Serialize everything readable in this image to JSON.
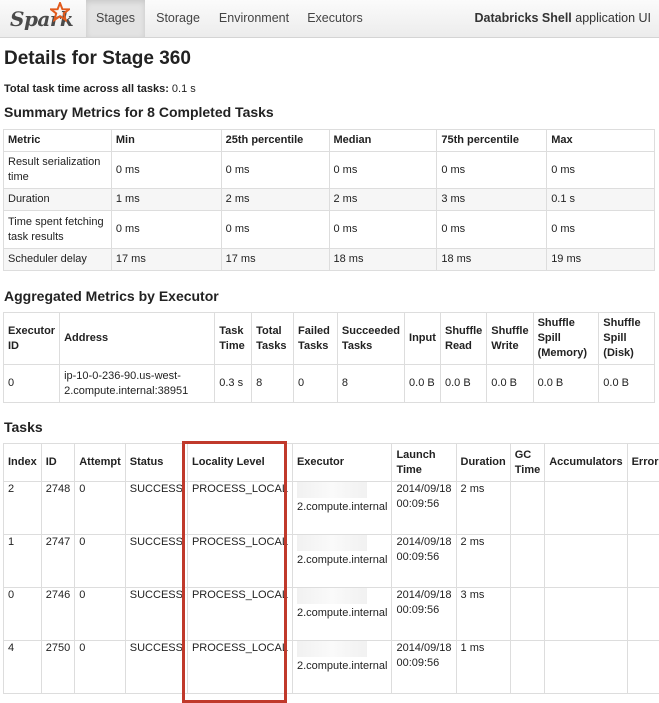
{
  "nav": {
    "brand": "Spark",
    "tabs": [
      "Stages",
      "Storage",
      "Environment",
      "Executors"
    ],
    "active_tab": "Stages",
    "app_name": "Databricks Shell",
    "app_suffix": " application UI"
  },
  "page": {
    "title": "Details for Stage 360",
    "total_label": "Total task time across all tasks:",
    "total_value": " 0.1 s"
  },
  "summary": {
    "heading": "Summary Metrics for 8 Completed Tasks",
    "columns": [
      "Metric",
      "Min",
      "25th percentile",
      "Median",
      "75th percentile",
      "Max"
    ],
    "rows": [
      [
        "Result serialization time",
        "0 ms",
        "0 ms",
        "0 ms",
        "0 ms",
        "0 ms"
      ],
      [
        "Duration",
        "1 ms",
        "2 ms",
        "2 ms",
        "3 ms",
        "0.1 s"
      ],
      [
        "Time spent fetching task results",
        "0 ms",
        "0 ms",
        "0 ms",
        "0 ms",
        "0 ms"
      ],
      [
        "Scheduler delay",
        "17 ms",
        "17 ms",
        "18 ms",
        "18 ms",
        "19 ms"
      ]
    ]
  },
  "aggregated": {
    "heading": "Aggregated Metrics by Executor",
    "columns": [
      "Executor ID",
      "Address",
      "Task Time",
      "Total Tasks",
      "Failed Tasks",
      "Succeeded Tasks",
      "Input",
      "Shuffle Read",
      "Shuffle Write",
      "Shuffle Spill (Memory)",
      "Shuffle Spill (Disk)"
    ],
    "rows": [
      [
        "0",
        "ip-10-0-236-90.us-west-2.compute.internal:38951",
        "0.3 s",
        "8",
        "0",
        "8",
        "0.0 B",
        "0.0 B",
        "0.0 B",
        "0.0 B",
        "0.0 B"
      ]
    ]
  },
  "tasks": {
    "heading": "Tasks",
    "columns": [
      "Index",
      "ID",
      "Attempt",
      "Status",
      "Locality Level",
      "Executor",
      "Launch Time",
      "Duration",
      "GC Time",
      "Accumulators",
      "Errors"
    ],
    "rows": [
      [
        "2",
        "2748",
        "0",
        "SUCCESS",
        "PROCESS_LOCAL",
        "2.compute.internal",
        "2014/09/18 00:09:56",
        "2 ms",
        "",
        "",
        ""
      ],
      [
        "1",
        "2747",
        "0",
        "SUCCESS",
        "PROCESS_LOCAL",
        "2.compute.internal",
        "2014/09/18 00:09:56",
        "2 ms",
        "",
        "",
        ""
      ],
      [
        "0",
        "2746",
        "0",
        "SUCCESS",
        "PROCESS_LOCAL",
        "2.compute.internal",
        "2014/09/18 00:09:56",
        "3 ms",
        "",
        "",
        ""
      ],
      [
        "4",
        "2750",
        "0",
        "SUCCESS",
        "PROCESS_LOCAL",
        "2.compute.internal",
        "2014/09/18 00:09:56",
        "1 ms",
        "",
        "",
        ""
      ]
    ]
  },
  "colors": {
    "highlight": "#c0392b",
    "brand_star": "#e25a1c"
  }
}
